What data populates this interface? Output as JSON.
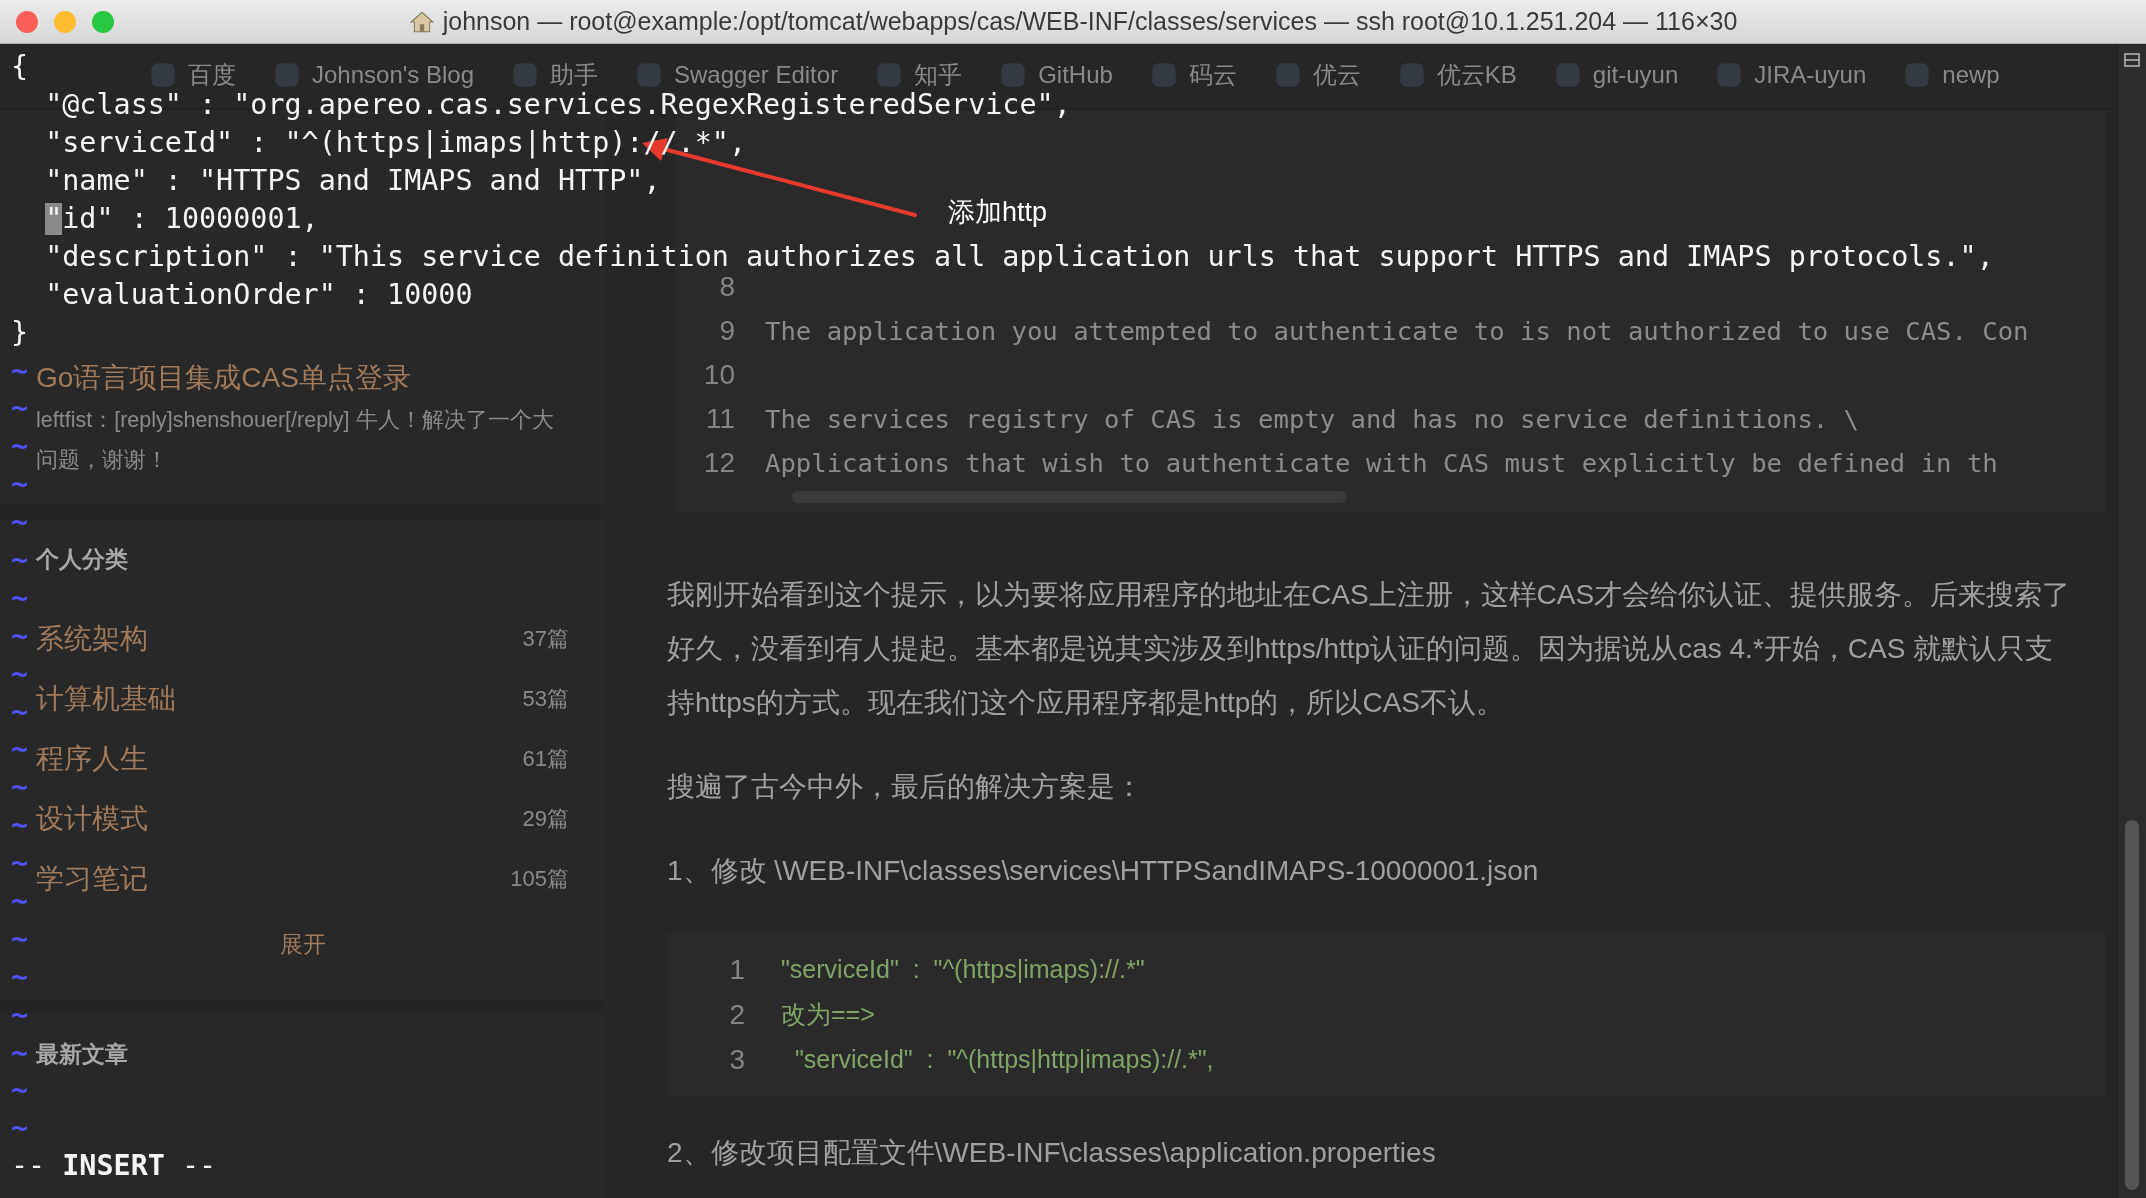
{
  "window": {
    "title": "johnson — root@example:/opt/tomcat/webapps/cas/WEB-INF/classes/services — ssh root@10.1.251.204 — 116×30"
  },
  "browser": {
    "bookmarks": [
      {
        "label": "百度"
      },
      {
        "label": "Johnson's Blog"
      },
      {
        "label": "助手"
      },
      {
        "label": "Swagger Editor"
      },
      {
        "label": "知乎"
      },
      {
        "label": "GitHub"
      },
      {
        "label": "码云"
      },
      {
        "label": "优云"
      },
      {
        "label": "优云KB"
      },
      {
        "label": "git-uyun"
      },
      {
        "label": "JIRA-uyun"
      },
      {
        "label": "newp"
      }
    ],
    "sidebar": {
      "comment": {
        "title": "Go语言项目集成CAS单点登录",
        "text": "leftfist：[reply]shenshouer[/reply] 牛人！解决了一个大问题，谢谢！"
      },
      "categories": {
        "title": "个人分类",
        "items": [
          {
            "name": "系统架构",
            "count": "37篇"
          },
          {
            "name": "计算机基础",
            "count": "53篇"
          },
          {
            "name": "程序人生",
            "count": "61篇"
          },
          {
            "name": "设计模式",
            "count": "29篇"
          },
          {
            "name": "学习笔记",
            "count": "105篇"
          }
        ],
        "expand": "展开"
      },
      "latest": {
        "title": "最新文章"
      }
    },
    "article": [
      {
        "kind": "code",
        "lines": [
          {
            "number": "8"
          },
          {
            "number": "9",
            "text": "The application you attempted to authenticate to is not authorized to use CAS. Con"
          },
          {
            "number": "10"
          },
          {
            "number": "11",
            "text": "The services registry of CAS is empty and has no service definitions. \\"
          },
          {
            "number": "12",
            "text": "Applications that wish to authenticate with CAS must explicitly be defined in th"
          }
        ]
      },
      {
        "kind": "paragraph",
        "text": "我刚开始看到这个提示，以为要将应用程序的地址在CAS上注册，这样CAS才会给你认证、提供服务。后来搜索了好久，没看到有人提起。基本都是说其实涉及到https/http认证的问题。因为据说从cas 4.*开始，CAS 就默认只支持https的方式。现在我们这个应用程序都是http的，所以CAS不认。"
      },
      {
        "kind": "paragraph",
        "text": "搜遍了古今中外，最后的解决方案是："
      },
      {
        "kind": "paragraph",
        "text": "1、修改 \\WEB-INF\\classes\\services\\HTTPSandIMAPS-10000001.json"
      },
      {
        "kind": "code",
        "lines": [
          {
            "number": "1",
            "text": "\"serviceId\"  :  \"^(https|imaps)://.*\""
          },
          {
            "number": "2",
            "text": "改为==>"
          },
          {
            "number": "3",
            "text": "  \"serviceId\"  :  \"^(https|http|imaps)://.*\","
          }
        ]
      },
      {
        "kind": "paragraph",
        "text": "2、修改项目配置文件\\WEB-INF\\classes\\application.properties"
      }
    ]
  },
  "terminal": {
    "lines": [
      {
        "text": "{",
        "cursor": false
      },
      {
        "text": "  \"@class\" : \"org.apereo.cas.services.RegexRegisteredService\",",
        "cursor": false
      },
      {
        "text": "  \"serviceId\" : \"^(https|imaps|http)://.*\",",
        "cursor": false
      },
      {
        "text": "  \"name\" : \"HTTPS and IMAPS and HTTP\",",
        "cursor": false
      },
      {
        "text": "  \"id\" : 10000001,",
        "cursor": true
      },
      {
        "text": "  \"description\" : \"This service definition authorizes all application urls that support HTTPS and IMAPS protocols.\",",
        "cursor": false
      },
      {
        "text": "  \"evaluationOrder\" : 10000",
        "cursor": false
      },
      {
        "text": "}",
        "cursor": false
      }
    ],
    "empty_lines": [
      "~",
      "~",
      "~",
      "~",
      "~",
      "~",
      "~",
      "~",
      "~",
      "~",
      "~",
      "~",
      "~",
      "~",
      "~",
      "~",
      "~",
      "~",
      "~",
      "~",
      "~"
    ],
    "mode": "-- **INSERT** --",
    "annotation": {
      "text": "添加http"
    }
  }
}
